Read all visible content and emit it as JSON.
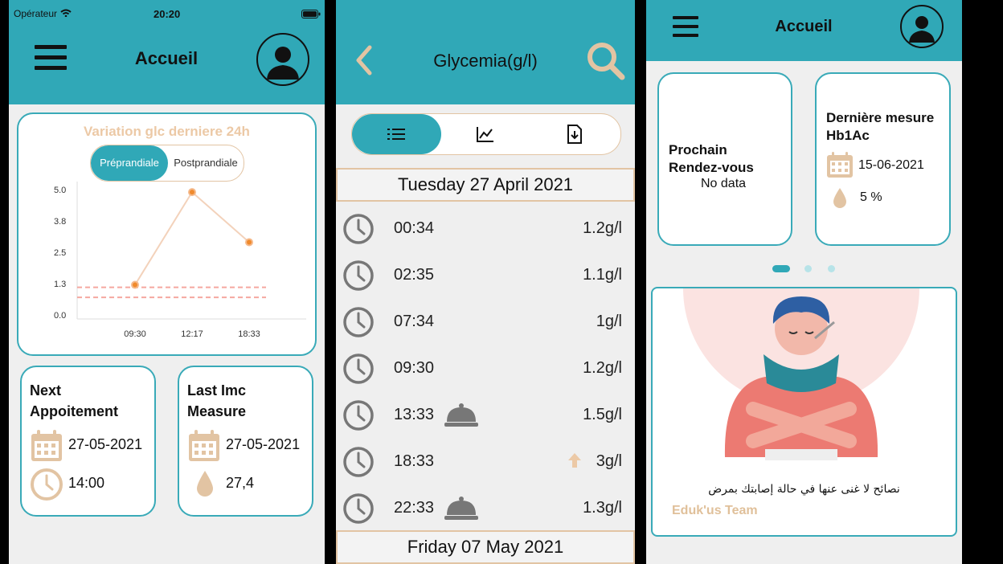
{
  "phone1": {
    "status": {
      "carrier": "Opérateur",
      "time": "20:20"
    },
    "header": {
      "title": "Accueil"
    },
    "chart_card": {
      "title": "Variation glc derniere 24h",
      "toggle": [
        "Préprandiale",
        "Postprandiale"
      ]
    },
    "chart_data": {
      "type": "line",
      "x": [
        "09:30",
        "12:17",
        "18:33"
      ],
      "y": [
        1.2,
        4.9,
        2.9
      ],
      "yticks": [
        "5.0",
        "3.8",
        "2.5",
        "1.3",
        "0.0"
      ],
      "ylim": [
        0,
        5
      ],
      "reference_lines": [
        1.1,
        0.7
      ],
      "colors": {
        "line": "#f3d2bb",
        "point": "#f08a2c",
        "reference": "#f5a8a0"
      }
    },
    "next_card": {
      "title_line1": "Next",
      "title_line2": "Appoitement",
      "date": "27-05-2021",
      "time": "14:00"
    },
    "imc_card": {
      "title_line1": "Last Imc",
      "title_line2": "Measure",
      "date": "27-05-2021",
      "value": "27,4"
    }
  },
  "phone2": {
    "header": {
      "title": "Glycemia(g/l)"
    },
    "tabs": [
      "list-icon",
      "chart-icon",
      "download-file-icon"
    ],
    "date1": "Tuesday 27 April 2021",
    "rows": [
      {
        "time": "00:34",
        "value": "1.2g/l",
        "marker": ""
      },
      {
        "time": "02:35",
        "value": "1.1g/l",
        "marker": ""
      },
      {
        "time": "07:34",
        "value": "1g/l",
        "marker": ""
      },
      {
        "time": "09:30",
        "value": "1.2g/l",
        "marker": ""
      },
      {
        "time": "13:33",
        "value": "1.5g/l",
        "marker": "bell"
      },
      {
        "time": "18:33",
        "value": "3g/l",
        "marker": "up"
      },
      {
        "time": "22:33",
        "value": "1.3g/l",
        "marker": "bell"
      }
    ],
    "date2": "Friday 07 May 2021"
  },
  "phone3": {
    "header": {
      "title": "Accueil"
    },
    "rdv_card": {
      "title_line1": "Prochain",
      "title_line2": "Rendez-vous",
      "text": "No data"
    },
    "hb_card": {
      "title_line1": "Dernière mesure",
      "title_line2": "Hb1Ac",
      "date": "15-06-2021",
      "value": "5 %"
    },
    "tip_card": {
      "text": "نصائح لا غنى عنها في حالة إصابتك بمرض",
      "author": "Eduk'us Team"
    },
    "colors": {
      "teal": "#30a8b7",
      "tan": "#e2c4a3",
      "accent_text": "#e0c09a"
    }
  }
}
